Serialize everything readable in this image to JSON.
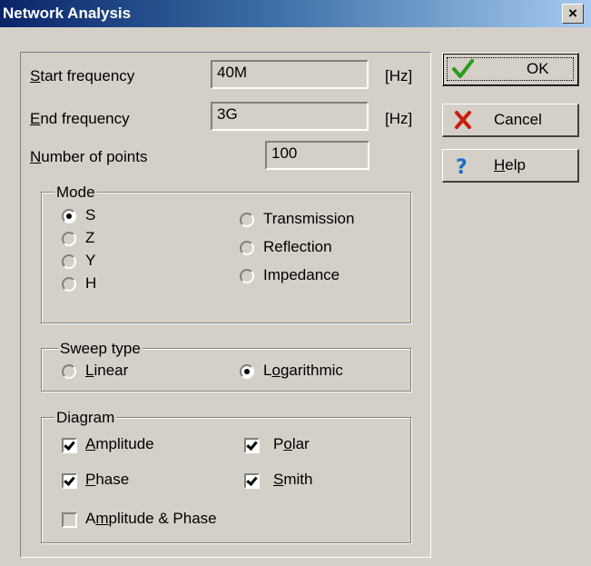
{
  "window": {
    "title": "Network Analysis",
    "close_glyph": "×"
  },
  "fields": {
    "start_frequency": {
      "label_ul": "S",
      "label_rest": "tart frequency",
      "value": "40M",
      "unit": "[Hz]"
    },
    "end_frequency": {
      "label_ul": "E",
      "label_rest": "nd frequency",
      "value": "3G",
      "unit": "[Hz]"
    },
    "number_of_points": {
      "label_ul": "N",
      "label_rest": "umber of points",
      "value": "100"
    }
  },
  "mode": {
    "title": "Mode",
    "options": [
      {
        "label": "S",
        "selected": true,
        "enabled": true
      },
      {
        "label": "Z",
        "selected": false,
        "enabled": false
      },
      {
        "label": "Y",
        "selected": false,
        "enabled": false
      },
      {
        "label": "H",
        "selected": false,
        "enabled": false
      },
      {
        "label": "Transmission",
        "selected": false,
        "enabled": false
      },
      {
        "label": "Reflection",
        "selected": false,
        "enabled": false
      },
      {
        "label": "Impedance",
        "selected": false,
        "enabled": false
      }
    ]
  },
  "sweep": {
    "title": "Sweep type",
    "linear": {
      "label_ul": "L",
      "label_rest": "inear",
      "selected": false
    },
    "logarithmic": {
      "label_pre": "L",
      "label_ul": "o",
      "label_rest": "garithmic",
      "selected": true
    }
  },
  "diagram": {
    "title": "Diagram",
    "amplitude": {
      "label_ul": "A",
      "label_rest": "mplitude",
      "checked": true
    },
    "phase": {
      "label_ul": "P",
      "label_rest": "hase",
      "checked": true
    },
    "amp_phase": {
      "label_pre": "A",
      "label_ul": "m",
      "label_rest": "plitude & Phase",
      "checked": false
    },
    "polar": {
      "label_pre": "P",
      "label_ul": "o",
      "label_rest": "lar",
      "checked": true
    },
    "smith": {
      "label_ul": "S",
      "label_rest": "mith",
      "checked": true
    }
  },
  "buttons": {
    "ok": {
      "label": "OK",
      "icon": "green-checkmark-icon"
    },
    "cancel": {
      "label": "Cancel",
      "icon": "red-x-icon"
    },
    "help": {
      "label_ul": "H",
      "label_rest": "elp",
      "icon": "question-mark-icon"
    }
  },
  "colors": {
    "dialog_bg": "#d4d0c8",
    "title_start": "#0a246a",
    "title_end": "#a6caf0",
    "ok_check": "#2e9a1e",
    "cancel_x": "#c81e0a",
    "help_q": "#1a6ec8"
  }
}
